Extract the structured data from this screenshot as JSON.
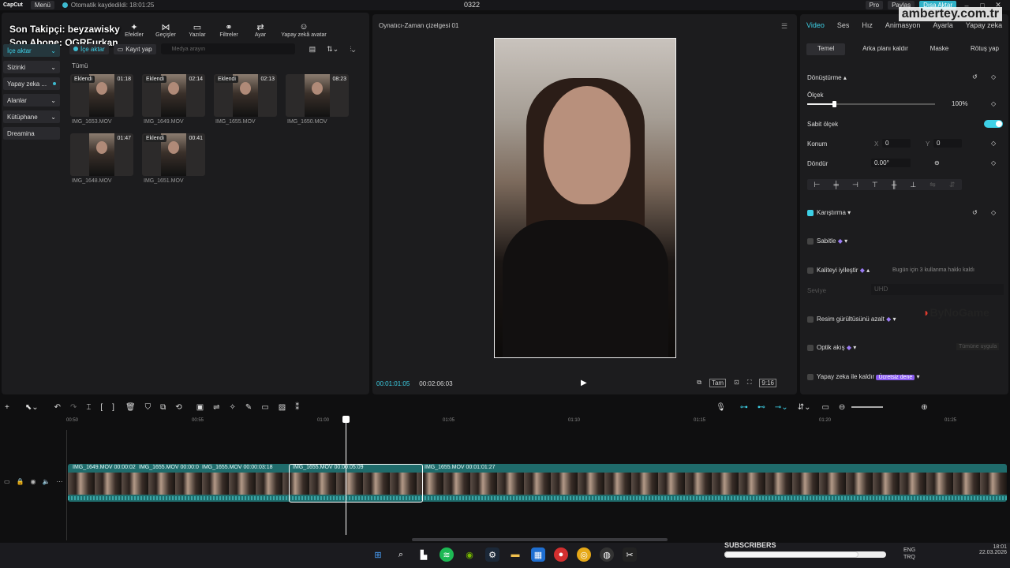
{
  "titlebar": {
    "logo": "CapCut",
    "menu": "Menü",
    "autosave": "Otomatik kaydedildi: 18:01:25",
    "project": "0322",
    "pro": "Pro",
    "share": "Paylaş",
    "export": "Dışa Aktar"
  },
  "overlay": {
    "follower": "Son Takipçi: beyzawisky",
    "subscriber": "Son Abone: OGRFurkan",
    "watermark": "ambertey.com.tr",
    "bynogame": "ByNoGame",
    "subscribers": "SUBSCRIBERS"
  },
  "tools": [
    "Efektler",
    "Geçişler",
    "Yazılar",
    "Filtreler",
    "Ayar",
    "Yapay zekâ avatar"
  ],
  "sidebar": [
    "İçe aktar",
    "Sizinki",
    "Yapay zeka ...",
    "Alanlar",
    "Kütüphane",
    "Dreamina"
  ],
  "media": {
    "import": "İçe aktar",
    "record": "Kayıt yap",
    "search_placeholder": "Medya arayın",
    "all": "Tümü",
    "items": [
      {
        "badge": "Eklendi",
        "duration": "01:18",
        "name": "IMG_1653.MOV"
      },
      {
        "badge": "Eklendi",
        "duration": "02:14",
        "name": "IMG_1649.MOV"
      },
      {
        "badge": "Eklendi",
        "duration": "02:13",
        "name": "IMG_1655.MOV"
      },
      {
        "badge": "",
        "duration": "08:23",
        "name": "IMG_1650.MOV"
      },
      {
        "badge": "",
        "duration": "01:47",
        "name": "IMG_1648.MOV"
      },
      {
        "badge": "Eklendi",
        "duration": "00:41",
        "name": "IMG_1651.MOV"
      }
    ]
  },
  "player": {
    "title": "Oynatıcı-Zaman çizelgesi 01",
    "current": "00:01:01:05",
    "total": "00:02:06:03",
    "full": "Tam",
    "ratio": "9:16"
  },
  "right": {
    "tabs": [
      "Video",
      "Ses",
      "Hız",
      "Animasyon",
      "Ayarla",
      "Yapay zeka"
    ],
    "subtabs": [
      "Temel",
      "Arka planı kaldır",
      "Maske",
      "Rötuş yap"
    ],
    "transform": "Dönüştürme",
    "scale": "Ölçek",
    "scale_value": "100%",
    "fixed_scale": "Sabit ölçek",
    "position": "Konum",
    "x_label": "X",
    "x_value": "0",
    "y_label": "Y",
    "y_value": "0",
    "rotate": "Döndür",
    "rotate_value": "0.00°",
    "blend": "Karıştırma",
    "stabilize": "Sabitle",
    "enhance": "Kaliteyi iyileştir",
    "enhance_note": "Bugün için 3 kullanma hakkı kaldı",
    "level": "Seviye",
    "level_value": "UHD",
    "denoise": "Resim gürültüsünü azalt",
    "optical": "Optik akış",
    "optical_apply": "Tümüne uygula",
    "ai_remove": "Yapay zeka ile kaldır",
    "ai_free": "Ücretsiz dene"
  },
  "timeline": {
    "ruler": [
      "00:50",
      "00:55",
      "01:00",
      "01:05",
      "01:10",
      "01:15",
      "01:20",
      "01:25"
    ],
    "clips": [
      {
        "label": "IMG_1649.MOV  00:00:02"
      },
      {
        "label": "IMG_1655.MOV  00:00:0"
      },
      {
        "label": "IMG_1655.MOV  00:00:03:18"
      },
      {
        "label": "IMG_1655.MOV  00:00:05:09"
      },
      {
        "label": "IMG_1655.MOV  00:01:01:27"
      }
    ]
  },
  "taskbar": {
    "lang": "ENG",
    "lang2": "TRQ",
    "time": "18:01",
    "date": "22.03.2026"
  },
  "colors": {
    "accent": "#3dd0e6",
    "track": "#1f6b6b"
  }
}
